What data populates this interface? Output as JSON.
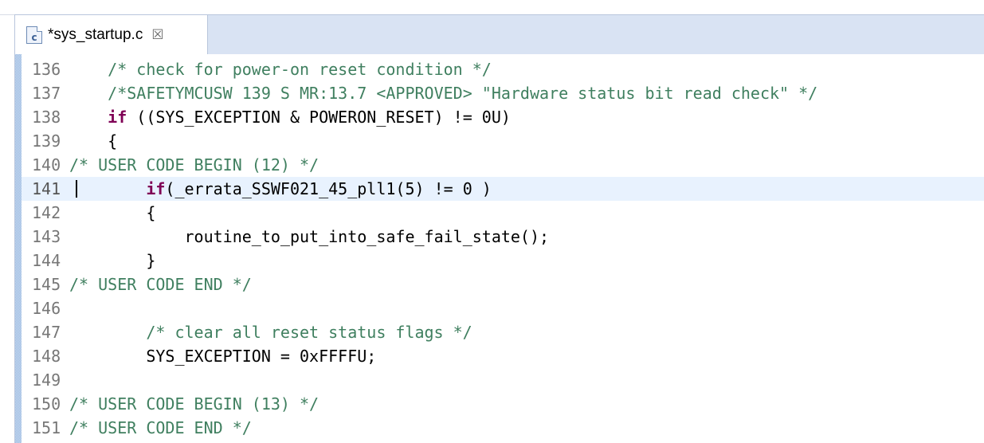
{
  "editor": {
    "tab": {
      "file_icon_letter": "c",
      "title": "*sys_startup.c",
      "close_symbol": "☒"
    },
    "lines": [
      {
        "number": "136",
        "indent": "    ",
        "parts": [
          {
            "t": "/* check for power-on reset condition */",
            "c": "comment"
          }
        ]
      },
      {
        "number": "137",
        "indent": "    ",
        "parts": [
          {
            "t": "/*SAFETYMCUSW 139 S MR:13.7 <APPROVED> \"Hardware status bit read check\" */",
            "c": "comment"
          }
        ]
      },
      {
        "number": "138",
        "indent": "    ",
        "parts": [
          {
            "t": "if",
            "c": "keyword"
          },
          {
            "t": " ((SYS_EXCEPTION & POWERON_RESET) != 0U)",
            "c": "code"
          }
        ]
      },
      {
        "number": "139",
        "indent": "    ",
        "parts": [
          {
            "t": "{",
            "c": "code"
          }
        ]
      },
      {
        "number": "140",
        "indent": "",
        "parts": [
          {
            "t": "/* USER CODE BEGIN (12) */",
            "c": "comment"
          }
        ]
      },
      {
        "number": "141",
        "indent": "        ",
        "current": true,
        "parts": [
          {
            "t": "if",
            "c": "keyword"
          },
          {
            "t": "(_errata_SSWF021_45_pll1(5) != 0 )",
            "c": "code"
          }
        ]
      },
      {
        "number": "142",
        "indent": "        ",
        "parts": [
          {
            "t": "{",
            "c": "code"
          }
        ]
      },
      {
        "number": "143",
        "indent": "            ",
        "parts": [
          {
            "t": "routine_to_put_into_safe_fail_state();",
            "c": "code"
          }
        ]
      },
      {
        "number": "144",
        "indent": "        ",
        "parts": [
          {
            "t": "}",
            "c": "code"
          }
        ]
      },
      {
        "number": "145",
        "indent": "",
        "parts": [
          {
            "t": "/* USER CODE END */",
            "c": "comment"
          }
        ]
      },
      {
        "number": "146",
        "indent": "",
        "parts": []
      },
      {
        "number": "147",
        "indent": "        ",
        "parts": [
          {
            "t": "/* clear all reset status flags */",
            "c": "comment"
          }
        ]
      },
      {
        "number": "148",
        "indent": "        ",
        "parts": [
          {
            "t": "SYS_EXCEPTION = 0xFFFFU;",
            "c": "code"
          }
        ]
      },
      {
        "number": "149",
        "indent": "",
        "parts": []
      },
      {
        "number": "150",
        "indent": "",
        "parts": [
          {
            "t": "/* USER CODE BEGIN (13) */",
            "c": "comment"
          }
        ]
      },
      {
        "number": "151",
        "indent": "",
        "parts": [
          {
            "t": "/* USER CODE END */",
            "c": "comment"
          }
        ]
      }
    ]
  },
  "colors": {
    "keyword": "#7f0055",
    "comment": "#3f7f5f",
    "code": "#000000",
    "line_number": "#777777",
    "current_line_bg": "#e8f2fe",
    "tab_bar_bg": "#d9e3f3"
  }
}
